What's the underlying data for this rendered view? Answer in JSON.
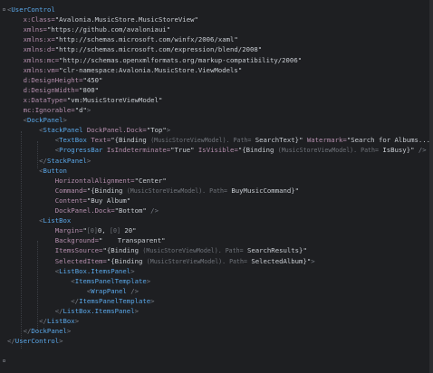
{
  "lines": [
    {
      "segments": [
        {
          "t": "<",
          "c": "bracket"
        },
        {
          "t": "UserControl",
          "c": "tag"
        }
      ]
    },
    {
      "segments": [
        {
          "t": "    x:Class=",
          "c": "attr"
        },
        {
          "t": "\"Avalonia.MusicStore.MusicStoreView\"",
          "c": "str"
        }
      ]
    },
    {
      "segments": [
        {
          "t": "    xmlns=",
          "c": "attr"
        },
        {
          "t": "\"https://github.com/avaloniaui\"",
          "c": "str"
        }
      ]
    },
    {
      "segments": [
        {
          "t": "    xmlns:x=",
          "c": "attr"
        },
        {
          "t": "\"http://schemas.microsoft.com/winfx/2006/xaml\"",
          "c": "str"
        }
      ]
    },
    {
      "segments": [
        {
          "t": "    xmlns:d=",
          "c": "attr"
        },
        {
          "t": "\"http://schemas.microsoft.com/expression/blend/2008\"",
          "c": "str"
        }
      ]
    },
    {
      "segments": [
        {
          "t": "    xmlns:mc=",
          "c": "attr"
        },
        {
          "t": "\"http://schemas.openxmlformats.org/markup-compatibility/2006\"",
          "c": "str"
        }
      ]
    },
    {
      "segments": [
        {
          "t": "    xmlns:vm=",
          "c": "attr"
        },
        {
          "t": "\"clr-namespace:Avalonia.MusicStore.ViewModels\"",
          "c": "str"
        }
      ]
    },
    {
      "segments": [
        {
          "t": "    d:DesignHeight=",
          "c": "attr"
        },
        {
          "t": "\"450\"",
          "c": "str"
        }
      ]
    },
    {
      "segments": [
        {
          "t": "    d:DesignWidth=",
          "c": "attr"
        },
        {
          "t": "\"800\"",
          "c": "str"
        }
      ]
    },
    {
      "segments": [
        {
          "t": "    x:DataType=",
          "c": "attr"
        },
        {
          "t": "\"vm:MusicStoreViewModel\"",
          "c": "str"
        }
      ]
    },
    {
      "segments": [
        {
          "t": "    mc:Ignorable=",
          "c": "attr"
        },
        {
          "t": "\"d\"",
          "c": "str"
        },
        {
          "t": ">",
          "c": "bracket"
        }
      ]
    },
    {
      "segments": [
        {
          "t": "    <",
          "c": "bracket"
        },
        {
          "t": "DockPanel",
          "c": "tag"
        },
        {
          "t": ">",
          "c": "bracket"
        }
      ]
    },
    {
      "segments": [
        {
          "t": "        <",
          "c": "bracket"
        },
        {
          "t": "StackPanel ",
          "c": "tag"
        },
        {
          "t": "DockPanel.Dock=",
          "c": "attr"
        },
        {
          "t": "\"Top\"",
          "c": "str"
        },
        {
          "t": ">",
          "c": "bracket"
        }
      ]
    },
    {
      "segments": [
        {
          "t": "            <",
          "c": "bracket"
        },
        {
          "t": "TextBox ",
          "c": "tag"
        },
        {
          "t": "Text=",
          "c": "attr"
        },
        {
          "t": "\"{Binding ",
          "c": "str"
        },
        {
          "t": "(MusicStoreViewModel). ",
          "c": "hint"
        },
        {
          "t": "Path=",
          "c": "hint"
        },
        {
          "t": " SearchText}\" ",
          "c": "str"
        },
        {
          "t": "Watermark=",
          "c": "attr"
        },
        {
          "t": "\"Search for Albums....\"",
          "c": "str"
        },
        {
          "t": " />",
          "c": "bracket"
        }
      ]
    },
    {
      "segments": [
        {
          "t": "            <",
          "c": "bracket"
        },
        {
          "t": "ProgressBar ",
          "c": "tag"
        },
        {
          "t": "IsIndeterminate=",
          "c": "attr"
        },
        {
          "t": "\"True\" ",
          "c": "str"
        },
        {
          "t": "IsVisible=",
          "c": "attr"
        },
        {
          "t": "\"{Binding ",
          "c": "str"
        },
        {
          "t": "(MusicStoreViewModel). ",
          "c": "hint"
        },
        {
          "t": "Path=",
          "c": "hint"
        },
        {
          "t": " IsBusy}\"",
          "c": "str"
        },
        {
          "t": " />",
          "c": "bracket"
        }
      ]
    },
    {
      "segments": [
        {
          "t": "        </",
          "c": "bracket"
        },
        {
          "t": "StackPanel",
          "c": "tag"
        },
        {
          "t": ">",
          "c": "bracket"
        }
      ]
    },
    {
      "segments": [
        {
          "t": "        <",
          "c": "bracket"
        },
        {
          "t": "Button",
          "c": "tag"
        }
      ]
    },
    {
      "segments": [
        {
          "t": "            HorizontalAlignment=",
          "c": "attr"
        },
        {
          "t": "\"Center\"",
          "c": "str"
        }
      ]
    },
    {
      "segments": [
        {
          "t": "            Command=",
          "c": "attr"
        },
        {
          "t": "\"{Binding ",
          "c": "str"
        },
        {
          "t": "(MusicStoreViewModel). ",
          "c": "hint"
        },
        {
          "t": "Path=",
          "c": "hint"
        },
        {
          "t": " BuyMusicCommand}\"",
          "c": "str"
        }
      ]
    },
    {
      "segments": [
        {
          "t": "            Content=",
          "c": "attr"
        },
        {
          "t": "\"Buy Album\"",
          "c": "str"
        }
      ]
    },
    {
      "segments": [
        {
          "t": "            DockPanel.Dock=",
          "c": "attr"
        },
        {
          "t": "\"Bottom\"",
          "c": "str"
        },
        {
          "t": " />",
          "c": "bracket"
        }
      ]
    },
    {
      "segments": [
        {
          "t": "        <",
          "c": "bracket"
        },
        {
          "t": "ListBox",
          "c": "tag"
        }
      ]
    },
    {
      "segments": [
        {
          "t": "            Margin=",
          "c": "attr"
        },
        {
          "t": "\"",
          "c": "str"
        },
        {
          "t": "[0]",
          "c": "hint"
        },
        {
          "t": "0, ",
          "c": "str"
        },
        {
          "t": "[0]",
          "c": "hint"
        },
        {
          "t": " 20\"",
          "c": "str"
        }
      ]
    },
    {
      "segments": [
        {
          "t": "            Background=",
          "c": "attr"
        },
        {
          "t": "\"",
          "c": "str"
        },
        {
          "t": "   ",
          "c": "hint"
        },
        {
          "t": " Transparent\"",
          "c": "str"
        }
      ]
    },
    {
      "segments": [
        {
          "t": "            ItemsSource=",
          "c": "attr"
        },
        {
          "t": "\"{Binding ",
          "c": "str"
        },
        {
          "t": "(MusicStoreViewModel). ",
          "c": "hint"
        },
        {
          "t": "Path=",
          "c": "hint"
        },
        {
          "t": " SearchResults}\"",
          "c": "str"
        }
      ]
    },
    {
      "segments": [
        {
          "t": "            SelectedItem=",
          "c": "attr"
        },
        {
          "t": "\"{Binding ",
          "c": "str"
        },
        {
          "t": "(MusicStoreViewModel). ",
          "c": "hint"
        },
        {
          "t": "Path=",
          "c": "hint"
        },
        {
          "t": " SelectedAlbum}\"",
          "c": "str"
        },
        {
          "t": ">",
          "c": "bracket"
        }
      ]
    },
    {
      "segments": [
        {
          "t": "            <",
          "c": "bracket"
        },
        {
          "t": "ListBox.ItemsPanel",
          "c": "tag"
        },
        {
          "t": ">",
          "c": "bracket"
        }
      ]
    },
    {
      "segments": [
        {
          "t": "                <",
          "c": "bracket"
        },
        {
          "t": "ItemsPanelTemplate",
          "c": "tag"
        },
        {
          "t": ">",
          "c": "bracket"
        }
      ]
    },
    {
      "segments": [
        {
          "t": "                    <",
          "c": "bracket"
        },
        {
          "t": "WrapPanel",
          "c": "tag"
        },
        {
          "t": " />",
          "c": "bracket"
        }
      ]
    },
    {
      "segments": [
        {
          "t": "                </",
          "c": "bracket"
        },
        {
          "t": "ItemsPanelTemplate",
          "c": "tag"
        },
        {
          "t": ">",
          "c": "bracket"
        }
      ]
    },
    {
      "segments": [
        {
          "t": "            </",
          "c": "bracket"
        },
        {
          "t": "ListBox.ItemsPanel",
          "c": "tag"
        },
        {
          "t": ">",
          "c": "bracket"
        }
      ]
    },
    {
      "segments": [
        {
          "t": "        </",
          "c": "bracket"
        },
        {
          "t": "ListBox",
          "c": "tag"
        },
        {
          "t": ">",
          "c": "bracket"
        }
      ]
    },
    {
      "segments": [
        {
          "t": "    </",
          "c": "bracket"
        },
        {
          "t": "DockPanel",
          "c": "tag"
        },
        {
          "t": ">",
          "c": "bracket"
        }
      ]
    },
    {
      "segments": [
        {
          "t": "</",
          "c": "bracket"
        },
        {
          "t": "UserControl",
          "c": "tag"
        },
        {
          "t": ">",
          "c": "bracket"
        }
      ]
    }
  ]
}
